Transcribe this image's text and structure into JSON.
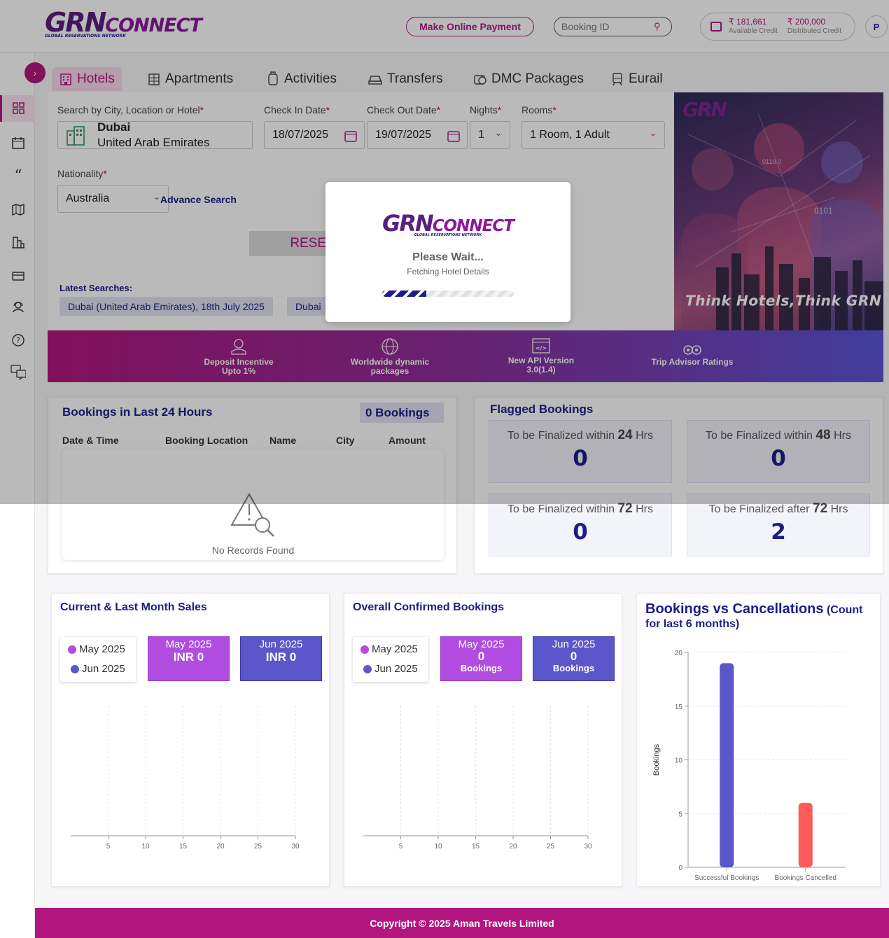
{
  "header": {
    "logo_main": "GRN",
    "logo_connect": "CONNECT",
    "logo_sub": "GLOBAL RESERVATIONS NETWORK",
    "pay_label": "Make Online Payment",
    "booking_placeholder": "Booking ID",
    "available_credit": "₹ 181,661",
    "available_credit_label": "Available Credit",
    "distributed_credit": "₹ 200,000",
    "distributed_credit_label": "Distributed Credit",
    "avatar_initial": "P"
  },
  "sidebar": {
    "icons": [
      "dashboard-icon",
      "calendar-icon",
      "quote-icon",
      "map-icon",
      "reports-icon",
      "payment-card-icon",
      "support-agent-icon",
      "help-icon",
      "feedback-icon"
    ]
  },
  "tabs": [
    {
      "label": "Hotels",
      "icon": "hotel-icon",
      "active": true
    },
    {
      "label": "Apartments",
      "icon": "apartment-icon"
    },
    {
      "label": "Activities",
      "icon": "activity-icon"
    },
    {
      "label": "Transfers",
      "icon": "car-icon"
    },
    {
      "label": "DMC Packages",
      "icon": "package-icon"
    },
    {
      "label": "Eurail",
      "icon": "train-icon"
    }
  ],
  "search": {
    "city_label": "Search by City, Location or Hotel",
    "city_name": "Dubai",
    "city_country": "United Arab Emirates",
    "checkin_label": "Check In Date",
    "checkin_value": "18/07/2025",
    "checkout_label": "Check Out Date",
    "checkout_value": "19/07/2025",
    "nights_label": "Nights",
    "nights_value": "1",
    "rooms_label": "Rooms",
    "rooms_value": "1 Room, 1 Adult",
    "nationality_label": "Nationality",
    "nationality_value": "Australia",
    "advance_search": "Advance Search",
    "reset_label": "RESET",
    "latest_label": "Latest Searches:",
    "latest": [
      "Dubai (United Arab Emirates), 18th July 2025",
      "Dubai"
    ]
  },
  "promo": {
    "logo": "GRN",
    "tagline": "Think Hotels,Think GRN",
    "binary_1": "0110 0",
    "binary_2": "0101"
  },
  "benefits": [
    {
      "line1": "Deposit Incentive",
      "line2": "Upto 1%",
      "icon": "deposit-icon"
    },
    {
      "line1": "Worldwide dynamic",
      "line2": "packages",
      "icon": "globe-icon"
    },
    {
      "line1": "New API Version",
      "line2": "3.0(1.4)",
      "icon": "code-window-icon"
    },
    {
      "line1": "Trip Advisor Ratings",
      "line2": "",
      "icon": "tripadvisor-icon"
    }
  ],
  "bookings24": {
    "title": "Bookings in Last 24 Hours",
    "count": "0 Bookings",
    "columns": [
      "Date & Time",
      "Booking Location",
      "Name",
      "City",
      "Amount"
    ],
    "empty_text": "No Records Found"
  },
  "flagged": {
    "title": "Flagged Bookings",
    "items": [
      {
        "prefix": "To be Finalized within",
        "hours": "24",
        "suffix": "Hrs",
        "value": "0"
      },
      {
        "prefix": "To be Finalized within",
        "hours": "48",
        "suffix": "Hrs",
        "value": "0"
      },
      {
        "prefix": "To be Finalized within",
        "hours": "72",
        "suffix": "Hrs",
        "value": "0"
      },
      {
        "prefix": "To be Finalized after",
        "hours": "72",
        "suffix": "Hrs",
        "value": "2"
      }
    ]
  },
  "sales": {
    "title": "Current & Last Month Sales",
    "legend": [
      "May 2025",
      "Jun 2025"
    ],
    "may_label": "May 2025",
    "may_value": "INR 0",
    "jun_label": "Jun 2025",
    "jun_value": "INR 0"
  },
  "confirmed": {
    "title": "Overall Confirmed Bookings",
    "legend": [
      "May 2025",
      "Jun 2025"
    ],
    "may_label": "May 2025",
    "may_value": "0",
    "may_sub": "Bookings",
    "jun_label": "Jun 2025",
    "jun_value": "0",
    "jun_sub": "Bookings"
  },
  "bvc": {
    "title": "Bookings vs Cancellations",
    "title_sub_1": "(Count",
    "title_sub_2": "for last 6 months)"
  },
  "colors": {
    "brand": "#b3177f",
    "navy": "#1d1d8a",
    "may": "#b04ce0",
    "jun": "#5b56c9",
    "cancel": "#ff5b5b"
  },
  "chart_data": [
    {
      "type": "line",
      "title": "",
      "x_ticks": [
        "5",
        "10",
        "15",
        "20",
        "25",
        "30"
      ],
      "series": []
    },
    {
      "type": "line",
      "title": "",
      "x_ticks": [
        "5",
        "10",
        "15",
        "20",
        "25",
        "30"
      ],
      "series": []
    },
    {
      "type": "bar",
      "title": "Bookings vs Cancellations (Count for last 6 months)",
      "categories": [
        "Successful Bookings",
        "Bookings Cancelled"
      ],
      "values": [
        19,
        6
      ],
      "ylabel": "Bookings",
      "ylim": [
        0,
        20
      ],
      "y_ticks": [
        "0",
        "5",
        "10",
        "15",
        "20"
      ],
      "bar_colors": [
        "#5b56c9",
        "#ff5b5b"
      ]
    }
  ],
  "loader": {
    "logo_main": "GRN",
    "logo_connect": "CONNECT",
    "logo_sub": "GLOBAL RESERVATIONS NETWORK",
    "title": "Please Wait...",
    "subtitle": "Fetching Hotel Details"
  },
  "footer": {
    "text": "Copyright © 2025 Aman Travels Limited"
  }
}
